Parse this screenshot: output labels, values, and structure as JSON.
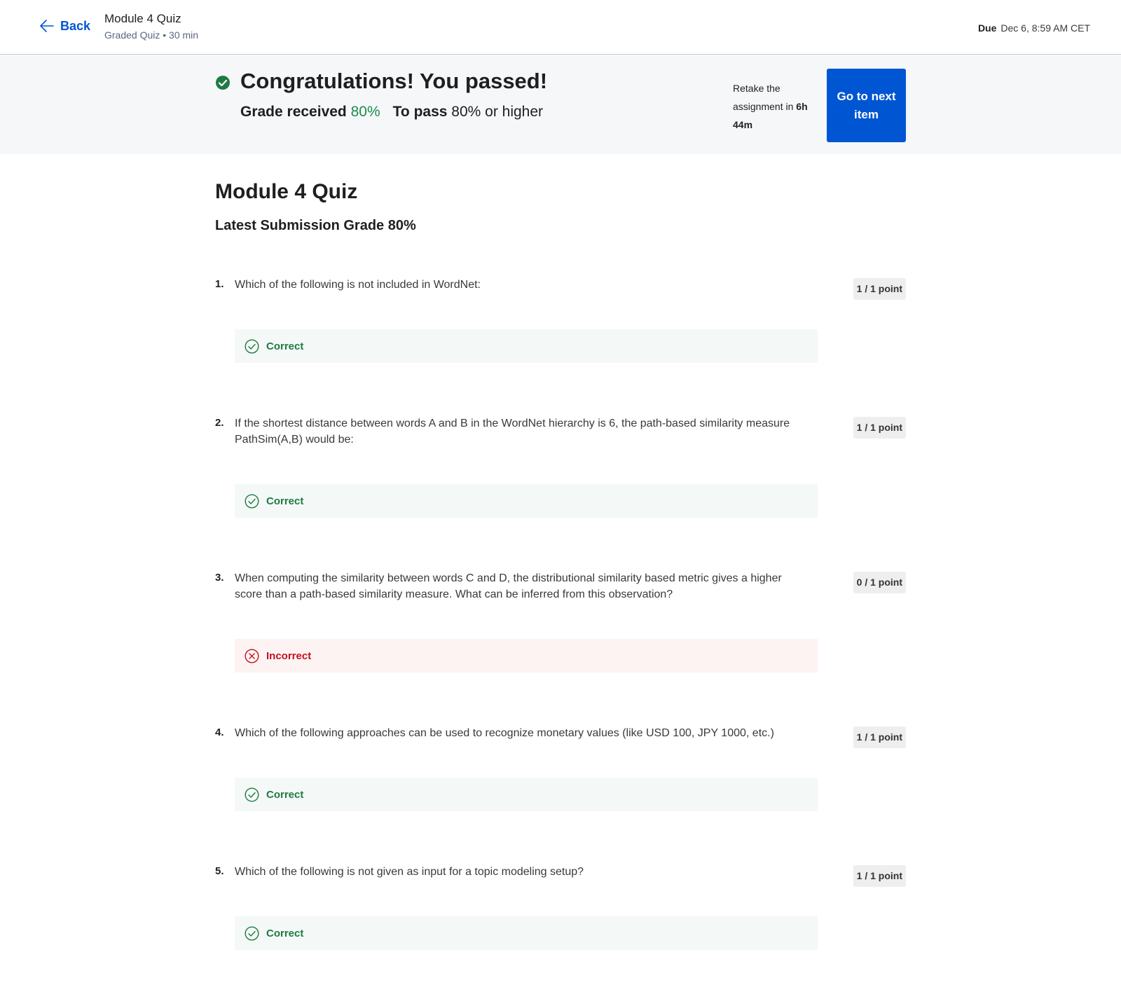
{
  "header": {
    "back_label": "Back",
    "title": "Module 4 Quiz",
    "subtitle": "Graded Quiz • 30 min",
    "due_label": "Due",
    "due_value": "Dec 6, 8:59 AM CET"
  },
  "banner": {
    "title": "Congratulations! You passed!",
    "grade_label": "Grade received",
    "grade_value": "80%",
    "pass_label": "To pass",
    "pass_value": "80% or higher",
    "retake_prefix": "Retake the assignment in",
    "retake_time": "6h 44m",
    "next_button_label": "Go to next item"
  },
  "main": {
    "title": "Module 4 Quiz",
    "subtitle": "Latest Submission Grade 80%"
  },
  "questions": [
    {
      "number": "1.",
      "text": "Which of the following is not included in WordNet:",
      "points": "1 / 1 point",
      "feedback": "Correct",
      "status": "correct"
    },
    {
      "number": "2.",
      "text": "If the shortest distance between words A and B in the WordNet hierarchy is 6, the path-based similarity measure PathSim(A,B) would be:",
      "points": "1 / 1 point",
      "feedback": "Correct",
      "status": "correct"
    },
    {
      "number": "3.",
      "text": "When computing the similarity between words C and D, the distributional similarity based metric gives a higher score than a path-based similarity measure. What can be inferred from this observation?",
      "points": "0 / 1 point",
      "feedback": "Incorrect",
      "status": "incorrect"
    },
    {
      "number": "4.",
      "text": "Which of the following approaches can be used to recognize monetary values (like USD 100, JPY 1000, etc.)",
      "points": "1 / 1 point",
      "feedback": "Correct",
      "status": "correct"
    },
    {
      "number": "5.",
      "text": "Which of the following is not given as input for a topic modeling setup?",
      "points": "1 / 1 point",
      "feedback": "Correct",
      "status": "correct"
    }
  ],
  "colors": {
    "brand_blue": "#0056d2",
    "success_green": "#1e8c4e",
    "error_red": "#c1121f"
  },
  "icons": {
    "back": "arrow-left-icon",
    "passed": "check-circle-filled-icon",
    "correct": "check-circle-outline-icon",
    "incorrect": "x-circle-outline-icon"
  }
}
